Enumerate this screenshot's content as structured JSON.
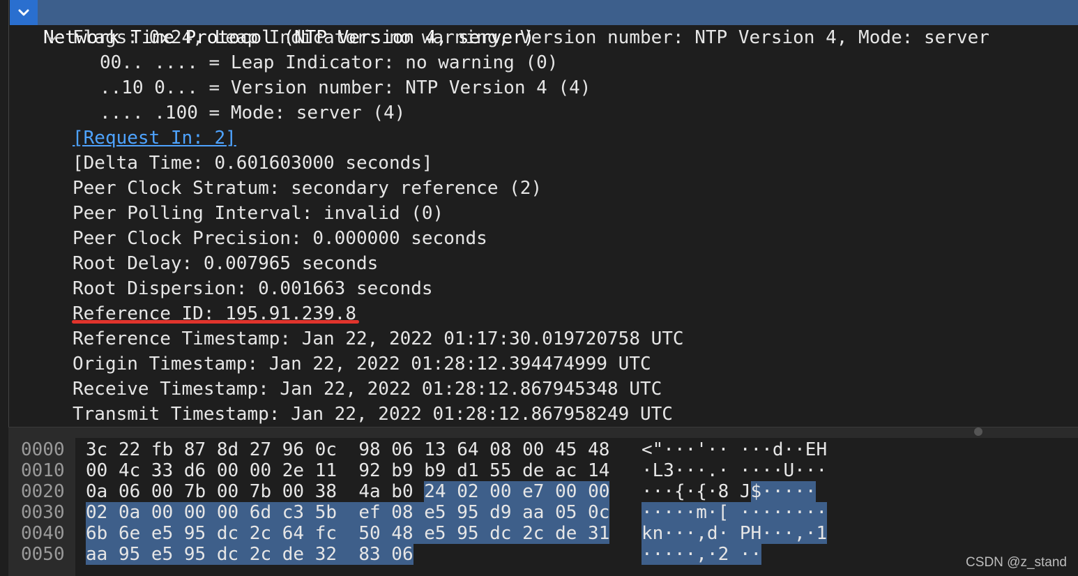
{
  "tree": {
    "header": "Network Time Protocol (NTP Version 4, server)",
    "flags": "Flags: 0x24, Leap Indicator: no warning, Version number: NTP Version 4, Mode: server",
    "flag_leap": "00.. .... = Leap Indicator: no warning (0)",
    "flag_version": "..10 0... = Version number: NTP Version 4 (4)",
    "flag_mode": ".... .100 = Mode: server (4)",
    "request_in": "[Request In: 2]",
    "delta_time": "[Delta Time: 0.601603000 seconds]",
    "stratum": "Peer Clock Stratum: secondary reference (2)",
    "polling": "Peer Polling Interval: invalid (0)",
    "precision": "Peer Clock Precision: 0.000000 seconds",
    "root_delay": "Root Delay: 0.007965 seconds",
    "root_dispersion": "Root Dispersion: 0.001663 seconds",
    "reference_id": "Reference ID: 195.91.239.8",
    "ref_ts": "Reference Timestamp: Jan 22, 2022 01:17:30.019720758 UTC",
    "origin_ts": "Origin Timestamp: Jan 22, 2022 01:28:12.394474999 UTC",
    "receive_ts": "Receive Timestamp: Jan 22, 2022 01:28:12.867945348 UTC",
    "transmit_ts": "Transmit Timestamp: Jan 22, 2022 01:28:12.867958249 UTC"
  },
  "hex": {
    "rows": [
      {
        "offset": "0000",
        "a": "3c 22 fb 87 8d 27 96 0c  98 06 13 64 08 00 45 48",
        "b": "",
        "c": "<\"···'·· ···d··EH",
        "d": ""
      },
      {
        "offset": "0010",
        "a": "00 4c 33 d6 00 00 2e 11  92 b9 b9 d1 55 de ac 14",
        "b": "",
        "c": "·L3···.· ····U···",
        "d": ""
      },
      {
        "offset": "0020",
        "a": "0a 06 00 7b 00 7b 00 38  4a b0 ",
        "b": "24 02 00 e7 00 00",
        "c": "···{·{·8 J",
        "d": "$·····"
      },
      {
        "offset": "0030",
        "a": "",
        "b": "02 0a 00 00 00 6d c3 5b  ef 08 e5 95 d9 aa 05 0c",
        "c": "",
        "d": "·····m·[ ········"
      },
      {
        "offset": "0040",
        "a": "",
        "b": "6b 6e e5 95 dc 2c 64 fc  50 48 e5 95 dc 2c de 31",
        "c": "",
        "d": "kn···,d· PH···,·1"
      },
      {
        "offset": "0050",
        "a": "",
        "b": "aa 95 e5 95 dc 2c de 32  83 06",
        "c": "",
        "d": "·····,·2 ··"
      }
    ]
  },
  "watermark": "CSDN @z_stand",
  "colors": {
    "accent": "#2a6fcf",
    "selection": "#3e5f8a",
    "link": "#4ea3ff",
    "underline": "#e0342c"
  }
}
